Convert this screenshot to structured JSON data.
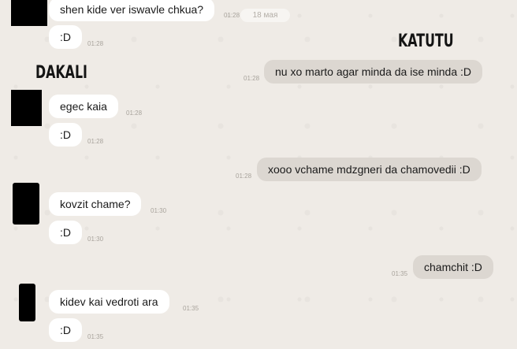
{
  "header": {
    "date_badge": "18 мая"
  },
  "labels": {
    "left_name": "DAKALI",
    "right_name": "KATUTU"
  },
  "messages": [
    {
      "side": "in",
      "text": "shen kide ver iswavle chkua?",
      "time": "01:28"
    },
    {
      "side": "in",
      "text": ":D",
      "time": "01:28"
    },
    {
      "side": "out",
      "text": "nu xo marto agar minda da ise minda :D",
      "time": "01:28"
    },
    {
      "side": "in",
      "text": "egec kaia",
      "time": "01:28"
    },
    {
      "side": "in",
      "text": ":D",
      "time": "01:28"
    },
    {
      "side": "out",
      "text": "xooo vchame mdzgneri da chamovedii :D",
      "time": "01:28"
    },
    {
      "side": "in",
      "text": "kovzit chame?",
      "time": "01:30"
    },
    {
      "side": "in",
      "text": ":D",
      "time": "01:30"
    },
    {
      "side": "out",
      "text": "chamchit :D",
      "time": "01:35"
    },
    {
      "side": "in",
      "text": "kidev kai vedroti ara",
      "time": "01:35"
    },
    {
      "side": "in",
      "text": ":D",
      "time": "01:35"
    }
  ]
}
